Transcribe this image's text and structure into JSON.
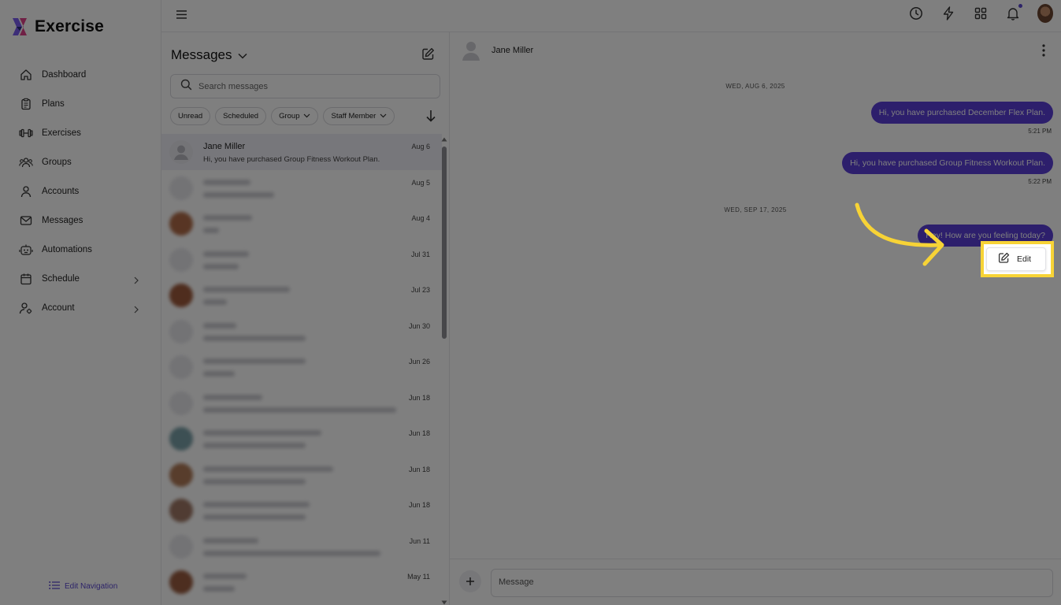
{
  "app": {
    "name": "Exercise"
  },
  "sidebar": {
    "items": [
      {
        "label": "Dashboard",
        "icon": "home-icon"
      },
      {
        "label": "Plans",
        "icon": "clipboard-icon"
      },
      {
        "label": "Exercises",
        "icon": "dumbbell-icon"
      },
      {
        "label": "Groups",
        "icon": "users-icon"
      },
      {
        "label": "Accounts",
        "icon": "user-icon"
      },
      {
        "label": "Messages",
        "icon": "mail-icon"
      },
      {
        "label": "Automations",
        "icon": "robot-icon"
      },
      {
        "label": "Schedule",
        "icon": "calendar-icon",
        "has_submenu": true
      },
      {
        "label": "Account",
        "icon": "user-gear-icon",
        "has_submenu": true
      }
    ],
    "edit_navigation": "Edit Navigation"
  },
  "messages_panel": {
    "title": "Messages",
    "search_placeholder": "Search messages",
    "filters": [
      "Unread",
      "Scheduled",
      "Group",
      "Staff Member"
    ],
    "conversations": [
      {
        "name": "Jane Miller",
        "preview": "Hi, you have purchased Group Fitness Workout Plan.",
        "date": "Aug 6",
        "selected": true
      },
      {
        "date": "Aug 5"
      },
      {
        "date": "Aug 4"
      },
      {
        "date": "Jul 31"
      },
      {
        "date": "Jul 23"
      },
      {
        "date": "Jun 30"
      },
      {
        "date": "Jun 26"
      },
      {
        "date": "Jun 18"
      },
      {
        "date": "Jun 18"
      },
      {
        "date": "Jun 18"
      },
      {
        "date": "Jun 18"
      },
      {
        "date": "Jun 11"
      },
      {
        "date": "May 11"
      }
    ]
  },
  "conversation": {
    "contact_name": "Jane Miller",
    "date_separators": [
      "WED, AUG 6, 2025",
      "WED, SEP 17, 2025"
    ],
    "messages": [
      {
        "text": "Hi, you have purchased December Flex Plan.",
        "time": "5:21 PM"
      },
      {
        "text": "Hi, you have purchased Group Fitness Workout Plan.",
        "time": "5:22 PM"
      },
      {
        "text": "Hey! How are you feeling today?",
        "time": ""
      }
    ],
    "context_menu": {
      "edit_label": "Edit"
    },
    "composer_placeholder": "Message"
  },
  "colors": {
    "accent": "#5b3fd9",
    "highlight": "#f7d336"
  }
}
